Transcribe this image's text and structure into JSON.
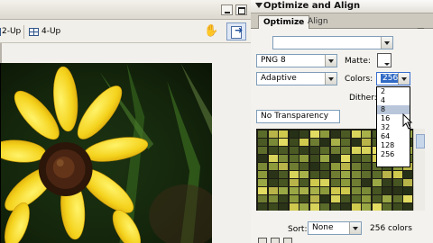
{
  "document": {
    "view_tabs": [
      {
        "label": "2-Up"
      },
      {
        "label": "4-Up"
      }
    ]
  },
  "panel": {
    "title": "Optimize and Align",
    "tabs": [
      {
        "label": "Optimize",
        "active": true
      },
      {
        "label": "Align",
        "active": false
      }
    ],
    "saved_settings": {
      "value": ""
    },
    "export_format": {
      "value": "PNG 8"
    },
    "matte": {
      "label": "Matte:",
      "color": "#ffffff"
    },
    "palette": {
      "value": "Adaptive"
    },
    "colors": {
      "label": "Colors:",
      "value": "256",
      "options": [
        "2",
        "4",
        "8",
        "16",
        "32",
        "64",
        "128",
        "256"
      ],
      "hover_option": "8"
    },
    "dither": {
      "label": "Dither:"
    },
    "transparency": {
      "value": "No Transparency"
    },
    "sort": {
      "label": "Sort:",
      "value": "None"
    },
    "color_count": "256 colors"
  },
  "colors": {
    "accent": "#316ac5",
    "swatches": [
      "#5a6b2a",
      "#8c9a3c",
      "#3d4a1e",
      "#b8b449",
      "#2a3318",
      "#6f7d33",
      "#cfc94e",
      "#4b5a24",
      "#9aa745",
      "#253016",
      "#d8d35a",
      "#7a8a37",
      "#34401c",
      "#a8b04a",
      "#5e6d2b",
      "#e2dc62",
      "#465521"
    ]
  }
}
